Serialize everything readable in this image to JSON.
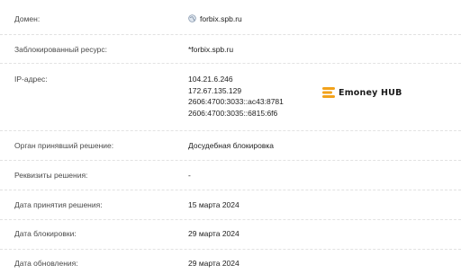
{
  "rows": {
    "domain": {
      "label": "Домен:",
      "value": "forbix.spb.ru",
      "icon": "globe-icon"
    },
    "blocked_resource": {
      "label": "Заблокированный ресурс:",
      "value": "*forbix.spb.ru"
    },
    "ip": {
      "label": "IP-адрес:",
      "values": [
        "104.21.6.246",
        "172.67.135.129",
        "2606:4700:3033::ac43:8781",
        "2606:4700:3035::6815:6f6"
      ]
    },
    "authority": {
      "label": "Орган принявший решение:",
      "value": "Досудебная блокировка"
    },
    "requisites": {
      "label": "Реквизиты решения:",
      "value": "-"
    },
    "decision_date": {
      "label": "Дата принятия решения:",
      "value": "15 марта 2024"
    },
    "block_date": {
      "label": "Дата блокировки:",
      "value": "29 марта 2024"
    },
    "update_date": {
      "label": "Дата обновления:",
      "value": "29 марта 2024"
    }
  },
  "watermark": {
    "brand_text": "Emoney HUB",
    "logo_color": "#f2a21b"
  }
}
